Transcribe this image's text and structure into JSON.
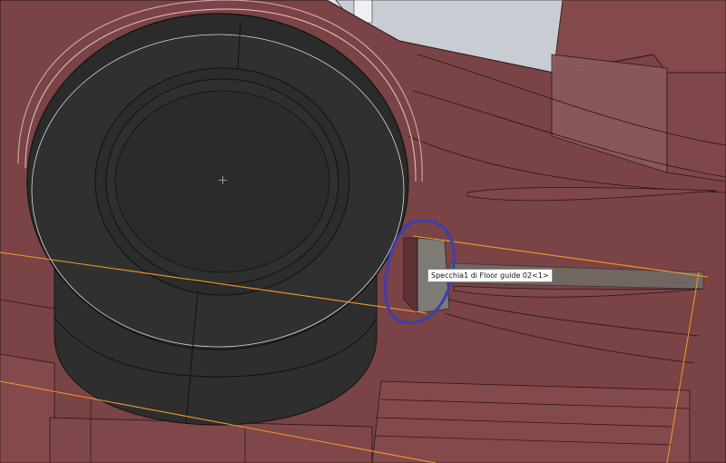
{
  "viewport": {
    "tooltip_text": "Specchia1 di Floor guide 02<1>"
  },
  "colors": {
    "body": "#7a4346",
    "body_light": "#84494b",
    "body_dark": "#5e3234",
    "tire": "#2e2e2e",
    "tire_edge": "#111111",
    "highlight": "#f39a2b",
    "annotation": "#3b3fb0",
    "background": "#dfe3e8"
  },
  "icons": {
    "origin": "origin-cross-icon"
  }
}
